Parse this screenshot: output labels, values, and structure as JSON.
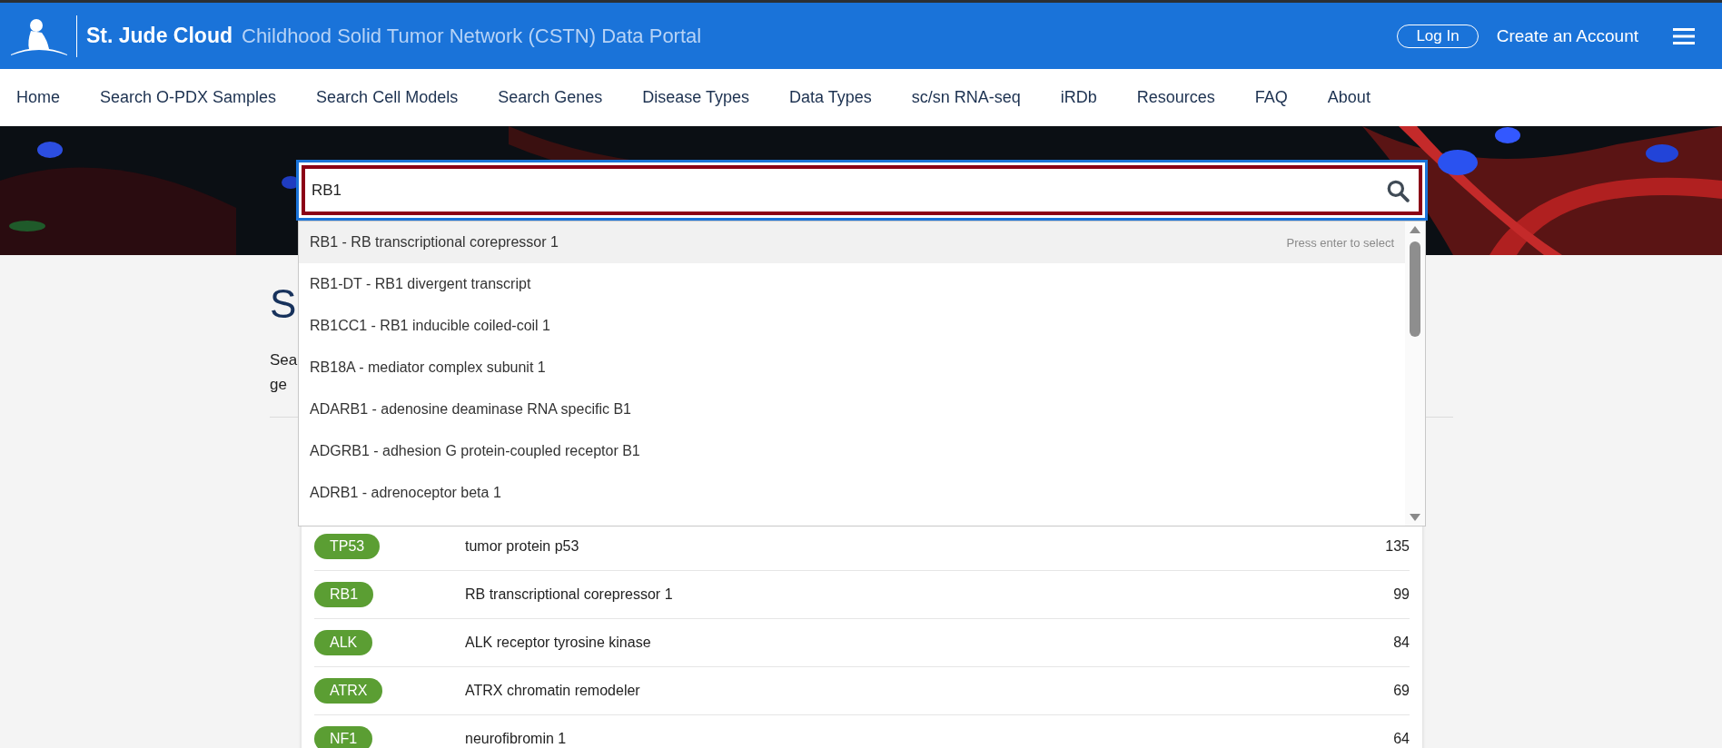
{
  "header": {
    "brand": "St. Jude Cloud",
    "subtitle": "Childhood Solid Tumor Network (CSTN) Data Portal",
    "login": "Log In",
    "create_account": "Create an Account"
  },
  "nav": [
    {
      "label": "Home"
    },
    {
      "label": "Search O-PDX Samples"
    },
    {
      "label": "Search Cell Models"
    },
    {
      "label": "Search Genes"
    },
    {
      "label": "Disease Types"
    },
    {
      "label": "Data Types"
    },
    {
      "label": "sc/sn RNA-seq"
    },
    {
      "label": "iRDb"
    },
    {
      "label": "Resources"
    },
    {
      "label": "FAQ"
    },
    {
      "label": "About"
    }
  ],
  "search": {
    "value": "RB1"
  },
  "dropdown": {
    "hint": "Press enter to select",
    "items": [
      {
        "label": "RB1 - RB transcriptional corepressor 1",
        "selected": true
      },
      {
        "label": "RB1-DT - RB1 divergent transcript",
        "selected": false
      },
      {
        "label": "RB1CC1 - RB1 inducible coiled-coil 1",
        "selected": false
      },
      {
        "label": "RB18A - mediator complex subunit 1",
        "selected": false
      },
      {
        "label": "ADARB1 - adenosine deaminase RNA specific B1",
        "selected": false
      },
      {
        "label": "ADGRB1 - adhesion G protein-coupled receptor B1",
        "selected": false
      },
      {
        "label": "ADRB1 - adrenoceptor beta 1",
        "selected": false
      }
    ]
  },
  "page": {
    "heading": "S",
    "intro_lines": [
      "Sea",
      "ge"
    ]
  },
  "genes": [
    {
      "symbol": "TP53",
      "name": "tumor protein p53",
      "count": "135"
    },
    {
      "symbol": "RB1",
      "name": "RB transcriptional corepressor 1",
      "count": "99"
    },
    {
      "symbol": "ALK",
      "name": "ALK receptor tyrosine kinase",
      "count": "84"
    },
    {
      "symbol": "ATRX",
      "name": "ATRX chromatin remodeler",
      "count": "69"
    },
    {
      "symbol": "NF1",
      "name": "neurofibromin 1",
      "count": "64"
    }
  ]
}
